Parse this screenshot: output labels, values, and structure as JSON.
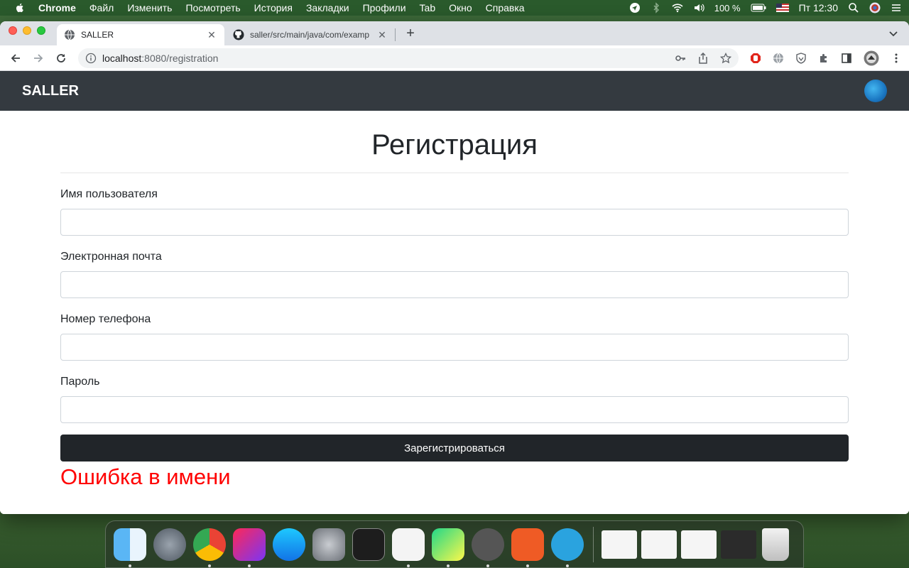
{
  "menubar": {
    "app_name": "Chrome",
    "items": [
      "Файл",
      "Изменить",
      "Посмотреть",
      "История",
      "Закладки",
      "Профили",
      "Tab",
      "Окно",
      "Справка"
    ],
    "battery": "100 %",
    "clock": "Пт 12:30"
  },
  "browser": {
    "tabs": [
      {
        "title": "SALLER",
        "icon": "globe-icon"
      },
      {
        "title": "saller/src/main/java/com/examp",
        "icon": "github-icon"
      }
    ],
    "url_host": "localhost",
    "url_path": ":8080/registration"
  },
  "page": {
    "brand": "SALLER",
    "heading": "Регистрация",
    "fields": [
      {
        "label": "Имя пользователя",
        "value": ""
      },
      {
        "label": "Электронная почта",
        "value": ""
      },
      {
        "label": "Номер телефона",
        "value": ""
      },
      {
        "label": "Пароль",
        "value": ""
      }
    ],
    "submit_label": "Зарегистрироваться",
    "error": "Ошибка в имени"
  },
  "colors": {
    "navbar": "#343a40",
    "button": "#212529",
    "error": "#ff0000"
  },
  "dock": {
    "apps": [
      "finder-icon",
      "launchpad-icon",
      "chrome-icon",
      "intellij-icon",
      "app-store-icon",
      "system-preferences-icon",
      "terminal-icon",
      "pycharm-ce-icon",
      "pycharm-icon",
      "sequel-icon",
      "postman-icon",
      "telegram-icon"
    ]
  }
}
